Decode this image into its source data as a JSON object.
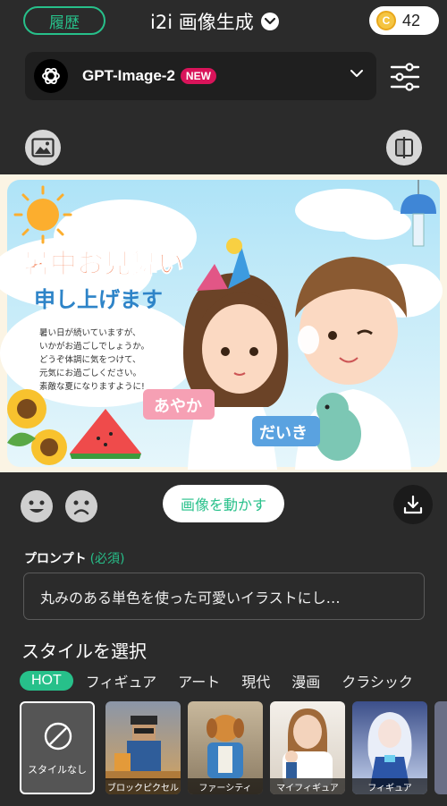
{
  "header": {
    "history_label": "履歴",
    "title": "i2i 画像生成",
    "credits": "42",
    "coin_letter": "C"
  },
  "model": {
    "name": "GPT-Image-2",
    "badge": "NEW"
  },
  "image": {
    "heading_line1": "暑中お見舞い",
    "heading_line2": "申し上げます",
    "message_lines": [
      "暑い日が続いていますが、",
      "いかがお過ごしでしょうか。",
      "どうぞ体調に気をつけて、",
      "元気にお過ごしください。",
      "素敵な夏になりますように!"
    ],
    "name_girl": "あやか",
    "name_boy": "だいき"
  },
  "actions": {
    "animate_label": "画像を動かす"
  },
  "prompt": {
    "label": "プロンプト",
    "required": "(必須)",
    "value": "丸みのある単色を使った可愛いイラストにし…"
  },
  "styles": {
    "title": "スタイルを選択",
    "tabs": [
      "HOT",
      "フィギュア",
      "アート",
      "現代",
      "漫画",
      "クラシック"
    ],
    "items": [
      {
        "label": "スタイルなし"
      },
      {
        "label": "ブロックピクセル"
      },
      {
        "label": "ファーシティ"
      },
      {
        "label": "マイフィギュア"
      },
      {
        "label": "フィギュア"
      }
    ]
  },
  "colors": {
    "accent": "#27c08a",
    "badge": "#d9145a",
    "background": "#2b2b2b"
  }
}
